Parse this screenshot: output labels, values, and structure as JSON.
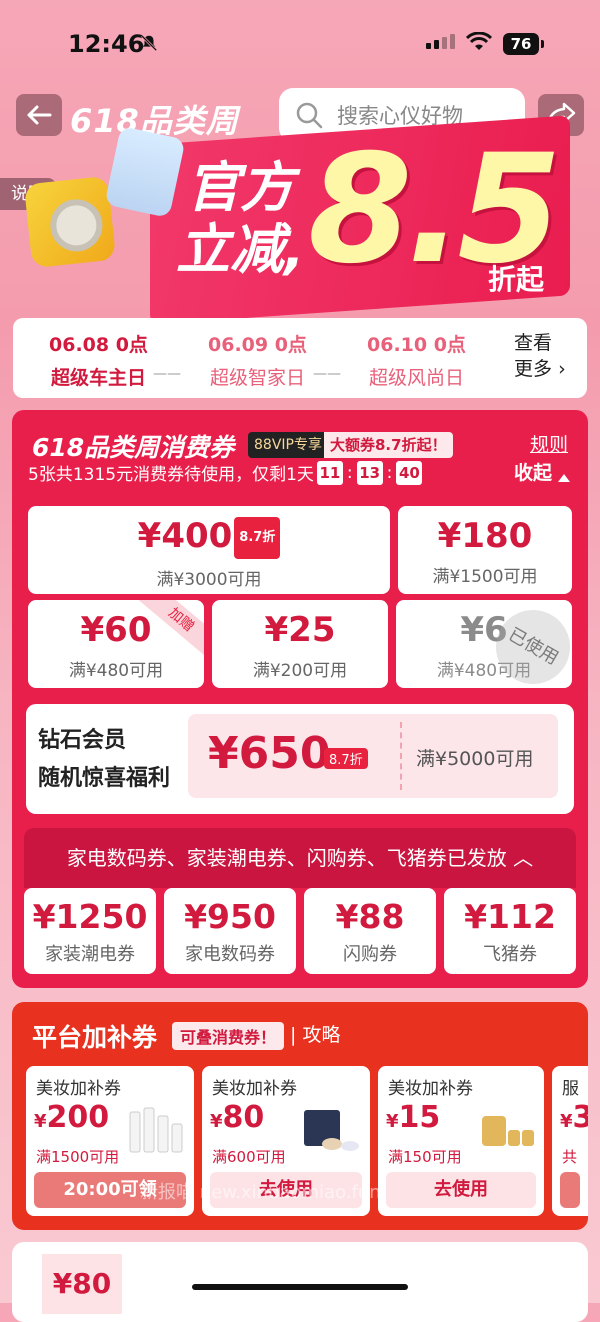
{
  "status": {
    "time": "12:46",
    "battery": "76"
  },
  "header": {
    "brand": "618品类周",
    "search_placeholder": "搜索心仪好物",
    "explain": "说明"
  },
  "hero": {
    "line1": "官方",
    "line2": "立减,",
    "number": "8.5",
    "suffix": "折起"
  },
  "dates": {
    "items": [
      {
        "date": "06.08 0点",
        "name": "超级车主日",
        "active": true
      },
      {
        "date": "06.09 0点",
        "name": "超级智家日",
        "active": false
      },
      {
        "date": "06.10 0点",
        "name": "超级风尚日",
        "active": false
      }
    ],
    "more_line1": "查看",
    "more_line2": "更多"
  },
  "coupons_panel": {
    "title": "618品类周消费券",
    "vip_badge": "88VIP专享",
    "promo_badge": "大额券8.7折起！",
    "rules": "规则",
    "collapse": "收起",
    "summary_prefix": "5张共1315元消费券待使用，仅剩1天",
    "countdown": [
      "11",
      "13",
      "40"
    ],
    "coupons": [
      {
        "amount": "¥400",
        "tag": "8.7折",
        "condition": "满¥3000可用"
      },
      {
        "amount": "¥180",
        "condition": "满¥1500可用"
      },
      {
        "amount": "¥60",
        "condition": "满¥480可用",
        "ribbon": "加赠"
      },
      {
        "amount": "¥25",
        "condition": "满¥200可用"
      },
      {
        "amount": "¥6",
        "condition": "满¥480可用",
        "stamp": "已使用"
      }
    ],
    "diamond": {
      "line1": "钻石会员",
      "line2": "随机惊喜福利",
      "amount": "¥650",
      "tag": "8.7折",
      "condition": "满¥5000可用"
    },
    "issued_text": "家电数码券、家装潮电券、闪购券、飞猪券已发放",
    "issued_coupons": [
      {
        "amount": "¥1250",
        "name": "家装潮电券"
      },
      {
        "amount": "¥950",
        "name": "家电数码券"
      },
      {
        "amount": "¥88",
        "name": "闪购券"
      },
      {
        "amount": "¥112",
        "name": "飞猪券"
      }
    ]
  },
  "platform": {
    "title": "平台加补券",
    "badge": "可叠消费券！",
    "guide": "攻略",
    "cards": [
      {
        "title": "美妆加补券",
        "currency": "¥",
        "value": "200",
        "condition": "满1500可用",
        "button": "20:00可领"
      },
      {
        "title": "美妆加补券",
        "currency": "¥",
        "value": "80",
        "condition": "满600可用",
        "button": "去使用"
      },
      {
        "title": "美妆加补券",
        "currency": "¥",
        "value": "15",
        "condition": "满150可用",
        "button": "去使用"
      },
      {
        "title": "服",
        "currency": "¥",
        "value": "3",
        "condition": "共",
        "button": ""
      }
    ]
  },
  "next": {
    "price": "¥80"
  },
  "watermark": "新报喵 new.xinbaomiao.fun",
  "colors": {
    "accent": "#e81f4a",
    "platform": "#e8311f",
    "price": "#d11a3d",
    "hero_number": "#fff7a8"
  }
}
